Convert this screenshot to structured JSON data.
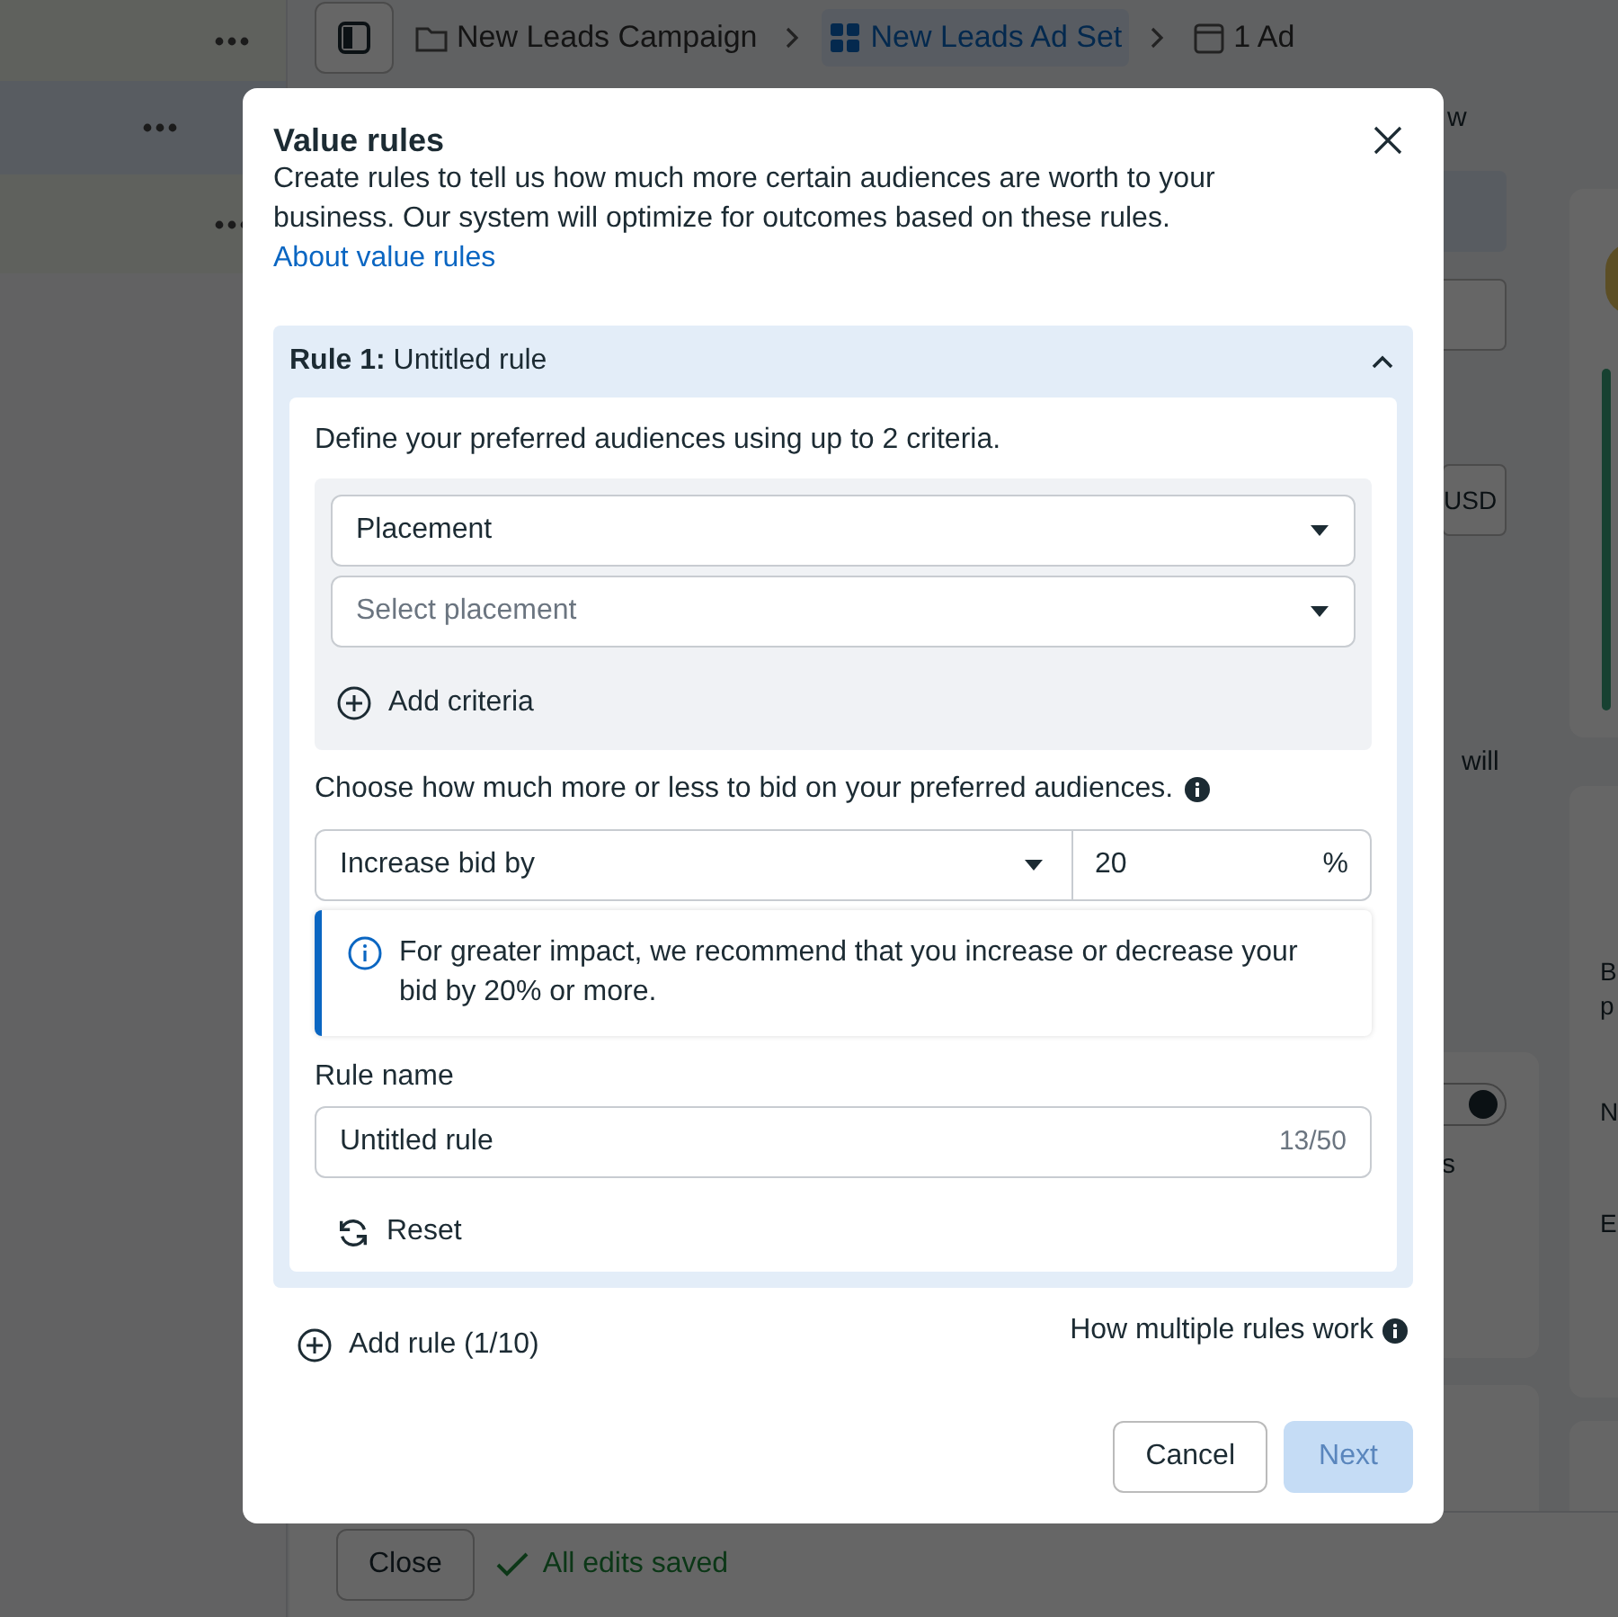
{
  "background": {
    "breadcrumb": [
      {
        "label": "New Leads Campaign",
        "kind": "folder",
        "selected": false
      },
      {
        "label": "New Leads Ad Set",
        "kind": "adset",
        "selected": true
      },
      {
        "label": "1 Ad",
        "kind": "ad",
        "selected": false
      }
    ],
    "fragments": [
      "w",
      "USD",
      "will",
      "s",
      "B",
      "p",
      "N",
      "E"
    ],
    "toggle_on": true,
    "close_button": "Close",
    "save_status": "All edits saved"
  },
  "dialog": {
    "title": "Value rules",
    "description": "Create rules to tell us how much more certain audiences are worth to your business. Our system will optimize for outcomes based on these rules.",
    "link": "About value rules",
    "rule": {
      "heading": "**Rule 1:** Untitled rule",
      "expanded": true,
      "criteria_prompt": "Define your preferred audiences using up to 2 criteria.",
      "criteria": [
        {
          "value": "Placement"
        },
        {
          "placeholder": "Select placement"
        }
      ],
      "add_criteria": "Add criteria",
      "bid_prompt": "Choose how much more or less to bid on your preferred audiences.",
      "bid_action": "Increase bid by",
      "bid_amount": "20",
      "bid_unit": "%",
      "tip": "For greater impact, we recommend that you increase or decrease your bid by 20% or more.",
      "name_label": "Rule name",
      "name_value": "Untitled rule",
      "name_count": "13/50",
      "reset": "Reset"
    },
    "add_rule": "Add rule (1/10)",
    "help_link": "How multiple rules work",
    "buttons": [
      {
        "label": "Cancel",
        "disabled": false
      },
      {
        "label": "Next",
        "disabled": true
      }
    ]
  }
}
